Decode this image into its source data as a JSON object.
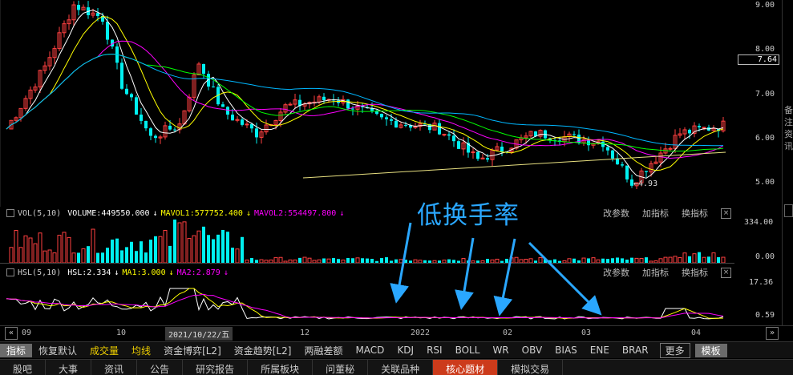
{
  "price_axis": [
    "9.00",
    "8.00",
    "7.00",
    "6.00",
    "5.00"
  ],
  "current_price": "7.64",
  "low_label": "4.93",
  "vol": {
    "param": "VOL(5,10)",
    "volume": "VOLUME:449550.000",
    "arrow1": "↓",
    "mavol1": "MAVOL1:577752.400",
    "arrow2": "↓",
    "mavol2": "MAVOL2:554497.800",
    "arrow3": "↓",
    "axis": [
      "334.00",
      "0.00"
    ]
  },
  "hsl": {
    "param": "HSL(5,10)",
    "hsl": "HSL:2.334",
    "arrow1": "↓",
    "ma1": "MA1:3.000",
    "arrow2": "↓",
    "ma2": "MA2:2.879",
    "arrow3": "↓",
    "axis": [
      "17.36",
      "0.59"
    ]
  },
  "panel_actions": {
    "modify": "改参数",
    "add": "加指标",
    "switch": "换指标",
    "close": "×"
  },
  "annotation": "低换手率",
  "timeline": {
    "left_arrow": "«",
    "right_arrow": "»",
    "labels": [
      "09",
      "10",
      "12",
      "2022",
      "02",
      "03",
      "04"
    ],
    "cursor": "2021/10/22/五"
  },
  "toolbar": [
    "指标",
    "恢复默认",
    "成交量",
    "均线",
    "资金博弈[L2]",
    "资金趋势[L2]",
    "两融差额",
    "MACD",
    "KDJ",
    "RSI",
    "BOLL",
    "WR",
    "OBV",
    "BIAS",
    "ENE",
    "BRAR"
  ],
  "toolbar_more": "更多",
  "toolbar_template": "模板",
  "tabs": [
    "股吧",
    "大事",
    "资讯",
    "公告",
    "研究报告",
    "所属板块",
    "问董秘",
    "关联品种",
    "核心题材",
    "模拟交易"
  ],
  "sidebar_text": "备注资讯",
  "colors": {
    "up": "#ff4040",
    "down": "#00f0f0",
    "ma5": "#ffffff",
    "ma10": "#ffff00",
    "ma20": "#ff00ff",
    "ma30": "#00ff00",
    "ma60": "#00b7ff",
    "accent": "#2aa7ff",
    "tab_active": "#cc3b1b"
  }
}
